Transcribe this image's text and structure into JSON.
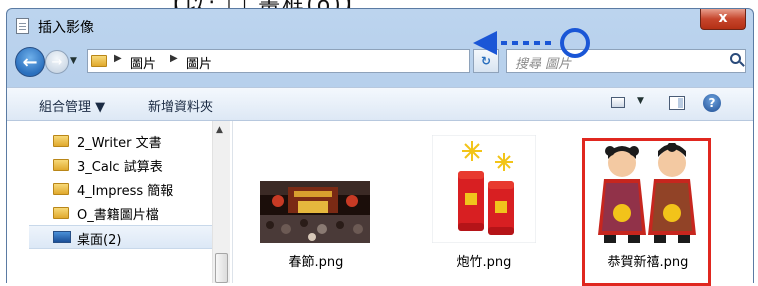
{
  "window": {
    "title": "插入影像",
    "close_label": "x"
  },
  "partial_heading": "【以: □ 畫框(o)】",
  "address_bar": {
    "crumbs": [
      "圖片",
      "圖片"
    ],
    "search_placeholder": "搜尋 圖片"
  },
  "toolbar": {
    "organize_label": "組合管理 ▼",
    "new_folder_label": "新增資料夾"
  },
  "nav_pane": {
    "items": [
      {
        "label": "2_Writer 文書"
      },
      {
        "label": "3_Calc 試算表"
      },
      {
        "label": "4_Impress 簡報"
      },
      {
        "label": "O_書籍圖片檔"
      }
    ],
    "selected": {
      "label": "桌面(2)"
    }
  },
  "files": [
    {
      "name": "春節.png",
      "selected": false
    },
    {
      "name": "炮竹.png",
      "selected": false
    },
    {
      "name": "恭賀新禧.png",
      "selected": true
    }
  ],
  "colors": {
    "selection_outline": "#e0271f",
    "accent": "#2a6fbd"
  }
}
